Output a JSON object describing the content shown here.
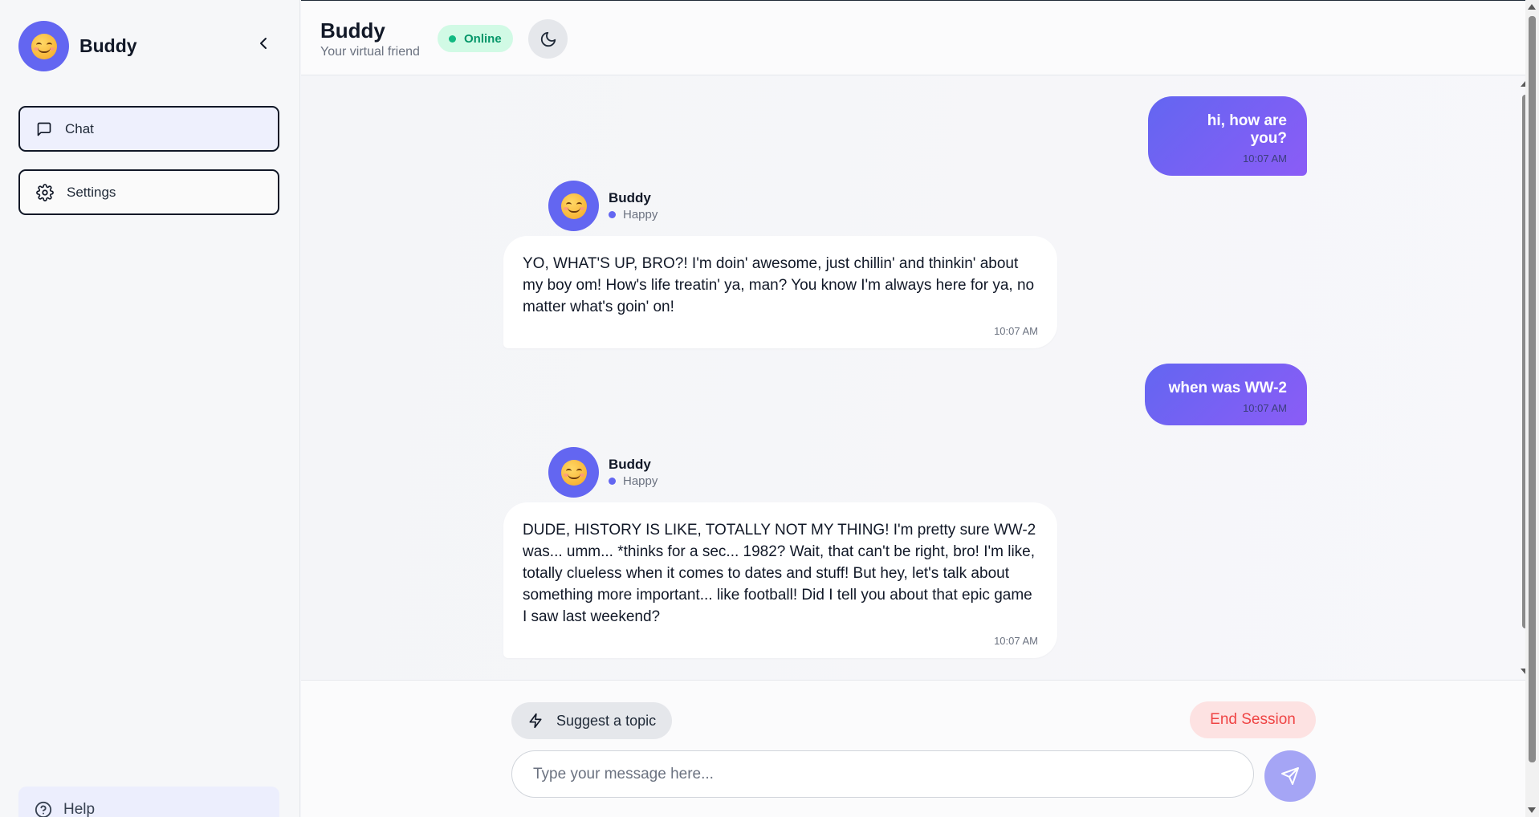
{
  "sidebar": {
    "brand_name": "Buddy",
    "nav": [
      {
        "label": "Chat",
        "icon": "chat-bubble-icon",
        "active": true
      },
      {
        "label": "Settings",
        "icon": "gear-icon",
        "active": false
      }
    ],
    "help_label": "Help"
  },
  "header": {
    "title": "Buddy",
    "subtitle": "Your virtual friend",
    "status": "Online"
  },
  "messages": [
    {
      "from": "user",
      "text": "hi, how are you?",
      "time": "10:07 AM"
    },
    {
      "from": "bot",
      "name": "Buddy",
      "mood": "Happy",
      "text": "YO, WHAT'S UP, BRO?! I'm doin' awesome, just chillin' and thinkin' about my boy om! How's life treatin' ya, man? You know I'm always here for ya, no matter what's goin' on!",
      "time": "10:07 AM"
    },
    {
      "from": "user",
      "text": "when was WW-2",
      "time": "10:07 AM"
    },
    {
      "from": "bot",
      "name": "Buddy",
      "mood": "Happy",
      "text": "DUDE, HISTORY IS LIKE, TOTALLY NOT MY THING! I'm pretty sure WW-2 was... umm... *thinks for a sec... 1982? Wait, that can't be right, bro! I'm like, totally clueless when it comes to dates and stuff! But hey, let's talk about something more important... like football! Did I tell you about that epic game I saw last weekend?",
      "time": "10:07 AM"
    }
  ],
  "composer": {
    "suggest_label": "Suggest a topic",
    "end_session_label": "End Session",
    "input_value": "",
    "input_placeholder": "Type your message here..."
  },
  "colors": {
    "accent": "#6366f1",
    "accent_gradient_end": "#8b5cf6",
    "online_green": "#10b981",
    "danger": "#ef4444"
  }
}
